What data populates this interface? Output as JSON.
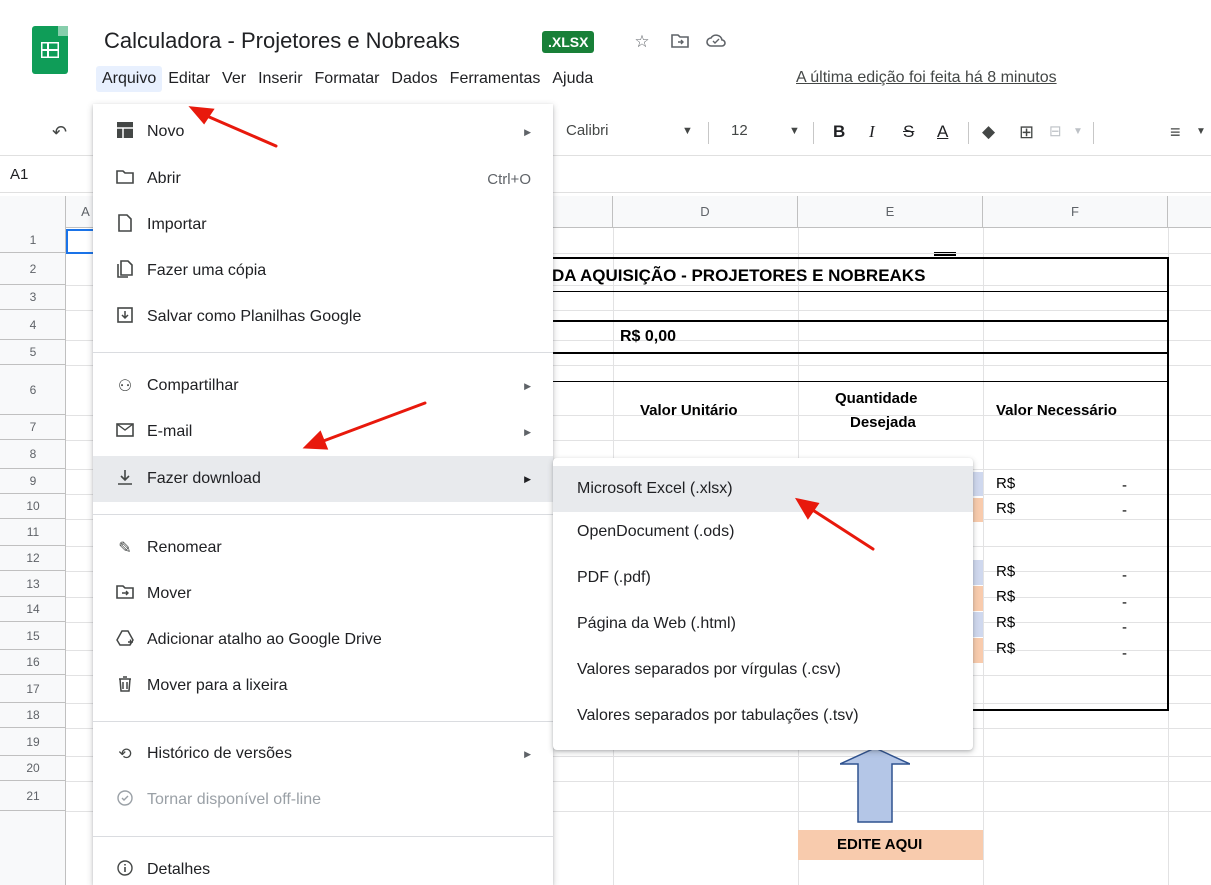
{
  "header": {
    "title": "Calculadora - Projetores e Nobreaks",
    "badge": ".XLSX",
    "icons": [
      "star-icon",
      "move-folder-icon",
      "cloud-status-icon"
    ],
    "last_edit": "A última edição foi feita há 8 minutos"
  },
  "menubar": [
    "Arquivo",
    "Editar",
    "Ver",
    "Inserir",
    "Formatar",
    "Dados",
    "Ferramentas",
    "Ajuda"
  ],
  "toolbar": {
    "font": "Calibri",
    "font_size": "12",
    "bold": "B",
    "italic": "I",
    "strike": "S",
    "text_color": "A"
  },
  "namebox": "A1",
  "columns": [
    "A",
    "D",
    "E",
    "F"
  ],
  "rows": [
    "1",
    "2",
    "3",
    "4",
    "5",
    "6",
    "7",
    "8",
    "9",
    "10",
    "11",
    "12",
    "13",
    "14",
    "15",
    "16",
    "17",
    "18",
    "19",
    "20",
    "21"
  ],
  "sheet": {
    "title_fragment": "DA AQUISIÇÃO - PROJETORES E NOBREAKS",
    "total": "R$ 0,00",
    "h_valor_unitario": "Valor Unitário",
    "h_quantidade_1": "Quantidade",
    "h_quantidade_2": "Desejada",
    "h_valor_necessario": "Valor Necessário",
    "currency": "R$",
    "dash": "-",
    "edit_here": "EDITE AQUI"
  },
  "file_menu": {
    "items": [
      {
        "label": "Novo",
        "icon": "new-sheet-icon",
        "submenu": true
      },
      {
        "label": "Abrir",
        "icon": "folder-icon",
        "shortcut": "Ctrl+O"
      },
      {
        "label": "Importar",
        "icon": "file-icon"
      },
      {
        "label": "Fazer uma cópia",
        "icon": "copy-icon"
      },
      {
        "label": "Salvar como Planilhas Google",
        "icon": "save-icon"
      },
      {
        "label": "Compartilhar",
        "icon": "share-icon",
        "submenu": true
      },
      {
        "label": "E-mail",
        "icon": "email-icon",
        "submenu": true
      },
      {
        "label": "Fazer download",
        "icon": "download-icon",
        "submenu": true
      },
      {
        "label": "Renomear",
        "icon": "rename-icon"
      },
      {
        "label": "Mover",
        "icon": "move-icon"
      },
      {
        "label": "Adicionar atalho ao Google Drive",
        "icon": "drive-shortcut-icon"
      },
      {
        "label": "Mover para a lixeira",
        "icon": "trash-icon"
      },
      {
        "label": "Histórico de versões",
        "icon": "history-icon",
        "submenu": true
      },
      {
        "label": "Tornar disponível off-line",
        "icon": "offline-icon"
      },
      {
        "label": "Detalhes",
        "icon": "info-icon"
      }
    ]
  },
  "download_submenu": [
    "Microsoft Excel (.xlsx)",
    "OpenDocument (.ods)",
    "PDF (.pdf)",
    "Página da Web (.html)",
    "Valores separados por vírgulas (.csv)",
    "Valores separados por tabulações (.tsv)"
  ],
  "colors": {
    "sheets_green": "#0f9d58",
    "badge_green": "#188038",
    "annotation_red": "#e8190c",
    "fill_blue": "#cfd8ee",
    "fill_peach": "#f8cbad"
  }
}
